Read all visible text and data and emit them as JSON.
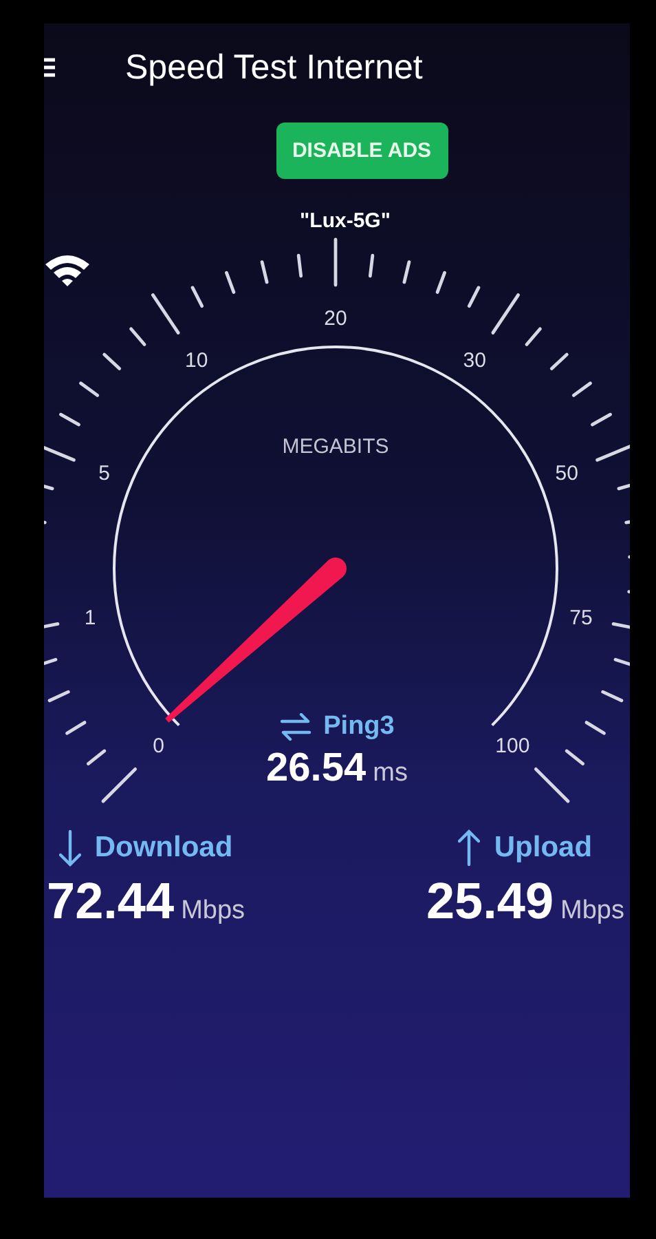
{
  "app_bar": {
    "title": "Speed Test Internet"
  },
  "disable_ads_button": {
    "label": "DISABLE ADS"
  },
  "network_name": "\"Lux-5G\"",
  "gauge": {
    "unit": "MEGABITS",
    "scale_labels": [
      "0",
      "1",
      "5",
      "10",
      "20",
      "30",
      "50",
      "75",
      "100"
    ]
  },
  "ping": {
    "label": "Ping3",
    "value": "26.54",
    "unit": "ms"
  },
  "results": [
    {
      "kind": "download",
      "label": "Download",
      "value": "72.44",
      "unit": "Mbps"
    },
    {
      "kind": "upload",
      "label": "Upload",
      "value": "25.49",
      "unit": "Mbps"
    }
  ]
}
